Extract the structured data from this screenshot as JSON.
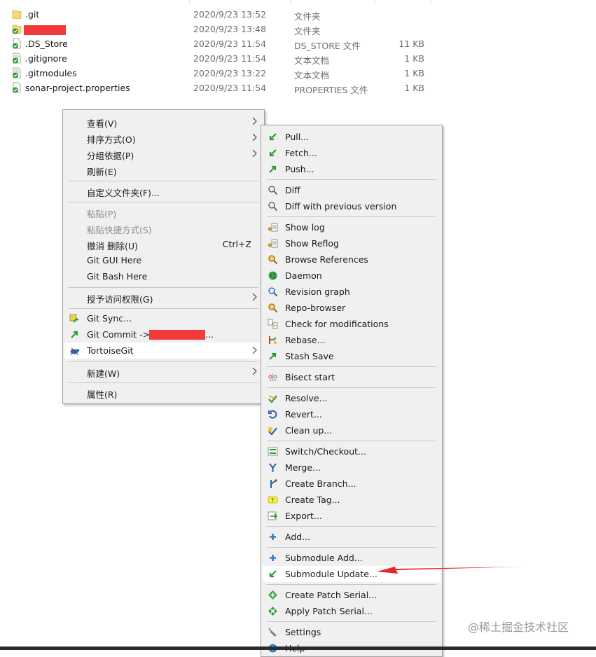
{
  "files": [
    {
      "name": ".git",
      "date": "2020/9/23 13:52",
      "type": "文件夹",
      "size": "",
      "icon": "folder-icon"
    },
    {
      "name": "",
      "date": "2020/9/23 13:48",
      "type": "文件夹",
      "size": "",
      "icon": "folder-git-clean-icon"
    },
    {
      "name": ".DS_Store",
      "date": "2020/9/23 11:54",
      "type": "DS_STORE 文件",
      "size": "11 KB",
      "icon": "file-git-clean-icon"
    },
    {
      "name": ".gitignore",
      "date": "2020/9/23 11:54",
      "type": "文本文档",
      "size": "1 KB",
      "icon": "file-git-clean-icon"
    },
    {
      "name": ".gitmodules",
      "date": "2020/9/23 13:22",
      "type": "文本文档",
      "size": "1 KB",
      "icon": "file-git-clean-icon"
    },
    {
      "name": "sonar-project.properties",
      "date": "2020/9/23 11:54",
      "type": "PROPERTIES 文件",
      "size": "1 KB",
      "icon": "file-git-clean-icon"
    }
  ],
  "context_menu": {
    "view": "查看(V)",
    "sort_by": "排序方式(O)",
    "group_by": "分组依据(P)",
    "refresh": "刷新(E)",
    "customize_folder": "自定义文件夹(F)...",
    "paste": "粘贴(P)",
    "paste_shortcut": "粘贴快捷方式(S)",
    "undo_delete": "撤消 删除(U)",
    "undo_shortcut": "Ctrl+Z",
    "git_gui_here": "Git GUI Here",
    "git_bash_here": "Git Bash Here",
    "give_access": "授予访问权限(G)",
    "git_sync": "Git Sync...",
    "git_commit_prefix": "Git Commit ->",
    "git_commit_suffix": "...",
    "tortoisegit": "TortoiseGit",
    "new": "新建(W)",
    "properties": "属性(R)"
  },
  "tortoise_menu": {
    "pull": "Pull...",
    "fetch": "Fetch...",
    "push": "Push...",
    "diff": "Diff",
    "diff_prev": "Diff with previous version",
    "show_log": "Show log",
    "show_reflog": "Show Reflog",
    "browse_refs": "Browse References",
    "daemon": "Daemon",
    "revision_graph": "Revision graph",
    "repo_browser": "Repo-browser",
    "check_mods": "Check for modifications",
    "rebase": "Rebase...",
    "stash_save": "Stash Save",
    "bisect_start": "Bisect start",
    "resolve": "Resolve...",
    "revert": "Revert...",
    "cleanup": "Clean up...",
    "switch_checkout": "Switch/Checkout...",
    "merge": "Merge...",
    "create_branch": "Create Branch...",
    "create_tag": "Create Tag...",
    "export": "Export...",
    "add": "Add...",
    "submodule_add": "Submodule Add...",
    "submodule_update": "Submodule Update...",
    "create_patch": "Create Patch Serial...",
    "apply_patch": "Apply Patch Serial...",
    "settings": "Settings",
    "help": "Help"
  },
  "watermark": "@稀土掘金技术社区",
  "colors": {
    "annotation_red": "#e8262b",
    "redaction_red": "#f23a3a",
    "menu_bg": "#f0f0f0",
    "git_green": "#2e9b32"
  }
}
